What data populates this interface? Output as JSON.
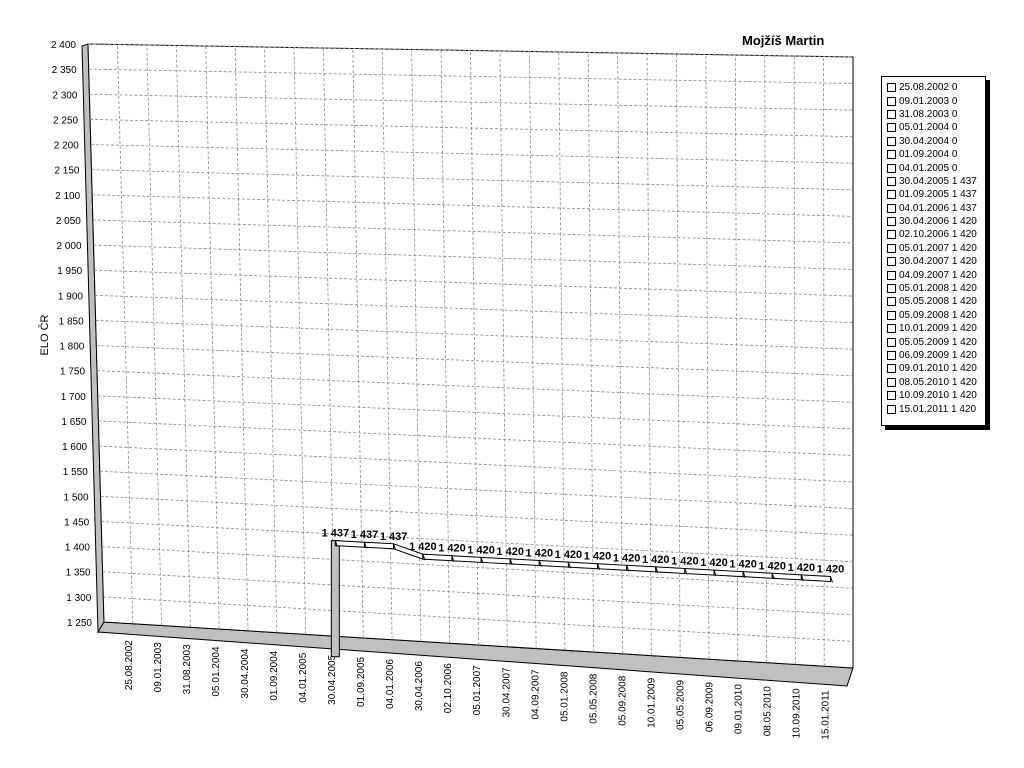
{
  "chart_data": {
    "type": "line",
    "title": "Mojžíš Martin",
    "ylabel": "ELO ČR",
    "xlabel": "",
    "ylim": [
      1250,
      2400
    ],
    "yticks": [
      "1 250",
      "1 300",
      "1 350",
      "1 400",
      "1 450",
      "1 500",
      "1 550",
      "1 600",
      "1 650",
      "1 700",
      "1 750",
      "1 800",
      "1 850",
      "1 900",
      "1 950",
      "2 000",
      "2 050",
      "2 100",
      "2 150",
      "2 200",
      "2 250",
      "2 300",
      "2 350",
      "2 400"
    ],
    "categories": [
      "25.08.2002",
      "09.01.2003",
      "31.08.2003",
      "05.01.2004",
      "30.04.2004",
      "01.09.2004",
      "04.01.2005",
      "30.04.2005",
      "01.09.2005",
      "04.01.2006",
      "30.04.2006",
      "02.10.2006",
      "05.01.2007",
      "30.04.2007",
      "04.09.2007",
      "05.01.2008",
      "05.05.2008",
      "05.09.2008",
      "10.01.2009",
      "05.05.2009",
      "06.09.2009",
      "09.01.2010",
      "08.05.2010",
      "10.09.2010",
      "15.01.2011"
    ],
    "values": [
      0,
      0,
      0,
      0,
      0,
      0,
      0,
      1437,
      1437,
      1437,
      1420,
      1420,
      1420,
      1420,
      1420,
      1420,
      1420,
      1420,
      1420,
      1420,
      1420,
      1420,
      1420,
      1420,
      1420
    ],
    "data_labels": [
      "",
      "",
      "",
      "",
      "",
      "",
      "",
      "1 437",
      "1 437",
      "1 437",
      "1 420",
      "1 420",
      "1 420",
      "1 420",
      "1 420",
      "1 420",
      "1 420",
      "1 420",
      "1 420",
      "1 420",
      "1 420",
      "1 420",
      "1 420",
      "1 420",
      "1 420"
    ],
    "legend": [
      "25.08.2002 0",
      "09.01.2003 0",
      "31.08.2003 0",
      "05.01.2004 0",
      "30.04.2004 0",
      "01.09.2004 0",
      "04.01.2005 0",
      "30.04.2005 1 437",
      "01.09.2005 1 437",
      "04.01.2006 1 437",
      "30.04.2006 1 420",
      "02.10.2006 1 420",
      "05.01.2007 1 420",
      "30.04.2007 1 420",
      "04.09.2007 1 420",
      "05.01.2008 1 420",
      "05.05.2008 1 420",
      "05.09.2008 1 420",
      "10.01.2009 1 420",
      "05.05.2009 1 420",
      "06.09.2009 1 420",
      "09.01.2010 1 420",
      "08.05.2010 1 420",
      "10.09.2010 1 420",
      "15.01.2011 1 420"
    ],
    "legend_position": "right",
    "grid": true,
    "style": "3d-perspective"
  }
}
